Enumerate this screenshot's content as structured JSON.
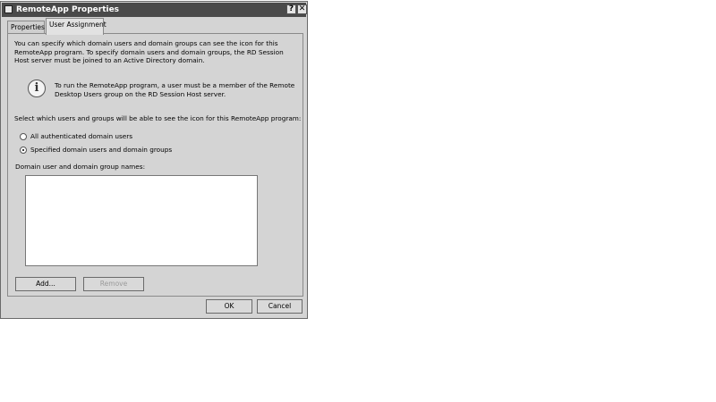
{
  "window": {
    "title": "RemoteApp Properties",
    "help_label": "?",
    "close_label": "✕"
  },
  "tabs": [
    {
      "label": "Properties",
      "active": false
    },
    {
      "label": "User Assignment",
      "active": true
    }
  ],
  "user_assignment": {
    "intro": "You can specify which domain users and domain groups can see the icon for this RemoteApp program. To specify domain users and domain groups, the RD Session Host server must be joined to an Active Directory domain.",
    "info_glyph": "i",
    "info_text": "To run the RemoteApp program, a user must be a member of the Remote Desktop Users group on the RD Session Host server.",
    "select_label": "Select which users and groups will be able to see the icon for this RemoteApp program:",
    "options": [
      {
        "label": "All authenticated domain users",
        "selected": false
      },
      {
        "label": "Specified domain users and domain groups",
        "selected": true
      }
    ],
    "list_label": "Domain user and domain group names:",
    "list_items": [],
    "add_label": "Add...",
    "remove_label": "Remove",
    "remove_enabled": false
  },
  "footer": {
    "ok_label": "OK",
    "cancel_label": "Cancel"
  }
}
